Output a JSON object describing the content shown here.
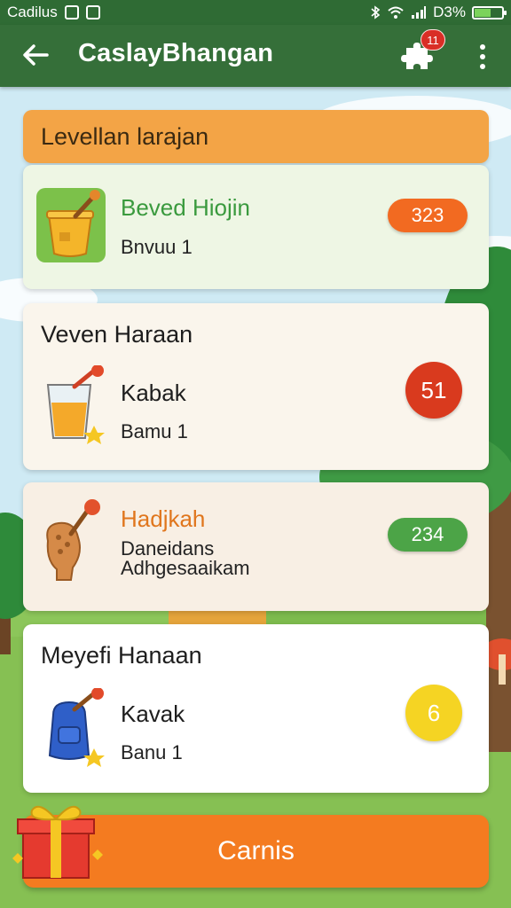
{
  "status_bar": {
    "carrier": "Cadilus",
    "battery": "D3%"
  },
  "app_bar": {
    "title": "CaslayBhangan",
    "notification_count": "11"
  },
  "section": {
    "title": "Levellan larajan"
  },
  "cards": [
    {
      "name": "Beved Hiojin",
      "subtitle": "Bnvuu 1",
      "value": "323",
      "value_style": "pill",
      "value_color": "#f26a21",
      "name_color": "#3a9a3e",
      "icon": "honey-pot-icon"
    },
    {
      "heading": "Veven Haraan",
      "name": "Kabak",
      "subtitle": "Bamu 1",
      "value": "51",
      "value_style": "circle",
      "value_color": "#d93a1e",
      "icon": "juice-glass-icon"
    },
    {
      "name": "Hadjkah",
      "subtitle": "Daneidans Adhgesaaikam",
      "value": "234",
      "value_style": "pill",
      "value_color": "#4ca447",
      "name_color": "#e0761d",
      "icon": "cookie-hand-icon"
    },
    {
      "heading": "Meyefi Hanaan",
      "name": "Kavak",
      "subtitle": "Banu 1",
      "value": "6",
      "value_style": "circle",
      "value_color": "#f5d423",
      "icon": "backpack-icon"
    }
  ],
  "bottom_button": {
    "label": "Carnis"
  }
}
